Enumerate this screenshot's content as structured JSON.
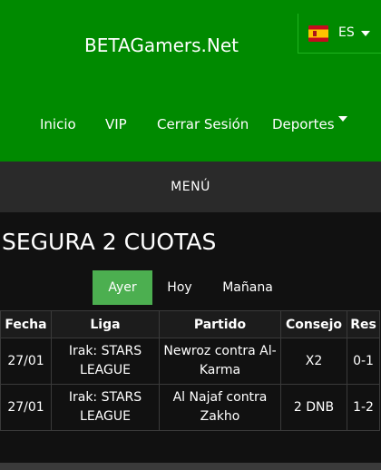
{
  "header": {
    "site_title": "BETAGamers.Net",
    "language": "ES",
    "background_color": "#008a00"
  },
  "nav": {
    "items": [
      "Inicio",
      "VIP",
      "Cerrar Sesión",
      "Deportes"
    ]
  },
  "menu": {
    "label": "MENÚ"
  },
  "main": {
    "title": "SEGURA 2 CUOTAS",
    "tabs": [
      {
        "label": "Ayer",
        "active": true
      },
      {
        "label": "Hoy",
        "active": false
      },
      {
        "label": "Mañana",
        "active": false
      }
    ],
    "accent_color": "#4caf50"
  },
  "table": {
    "headers": [
      "Fecha",
      "Liga",
      "Partido",
      "Consejo",
      "Res"
    ],
    "rows": [
      {
        "fecha": "27/01",
        "liga": "Irak: STARS LEAGUE",
        "partido": "Newroz contra Al-Karma",
        "consejo": "X2",
        "res": "0-1"
      },
      {
        "fecha": "27/01",
        "liga": "Irak: STARS LEAGUE",
        "partido": "Al Najaf contra Zakho",
        "consejo": "2 DNB",
        "res": "1-2"
      }
    ]
  }
}
